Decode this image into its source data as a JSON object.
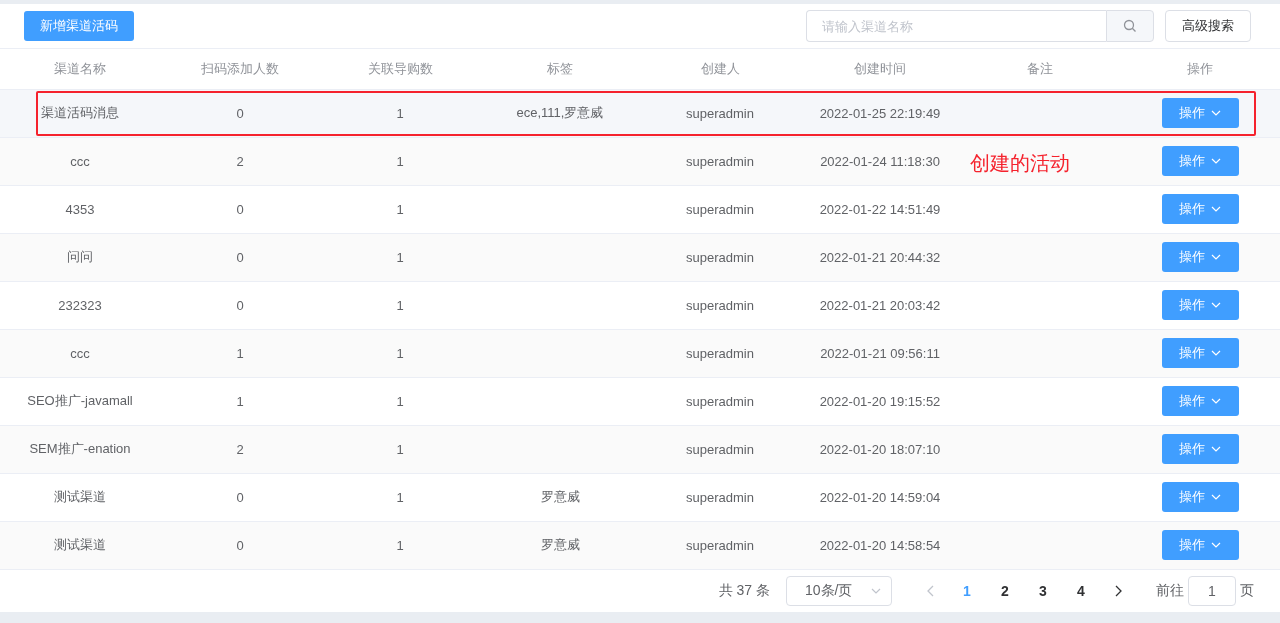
{
  "toolbar": {
    "add_button": "新增渠道活码",
    "search": {
      "placeholder": "请输入渠道名称"
    },
    "advanced_button": "高级搜索"
  },
  "table": {
    "columns": [
      "渠道名称",
      "扫码添加人数",
      "关联导购数",
      "标签",
      "创建人",
      "创建时间",
      "备注",
      "操作"
    ],
    "rows": [
      {
        "cells": [
          "渠道活码消息",
          "0",
          "1",
          "ece,111,罗意威",
          "superadmin",
          "2022-01-25 22:19:49",
          ""
        ],
        "action": "操作",
        "highlighted": true
      },
      {
        "cells": [
          "ccc",
          "2",
          "1",
          "",
          "superadmin",
          "2022-01-24 11:18:30",
          ""
        ],
        "action": "操作",
        "highlighted": false
      },
      {
        "cells": [
          "4353",
          "0",
          "1",
          "",
          "superadmin",
          "2022-01-22 14:51:49",
          ""
        ],
        "action": "操作",
        "highlighted": false
      },
      {
        "cells": [
          "问问",
          "0",
          "1",
          "",
          "superadmin",
          "2022-01-21 20:44:32",
          ""
        ],
        "action": "操作",
        "highlighted": false
      },
      {
        "cells": [
          "232323",
          "0",
          "1",
          "",
          "superadmin",
          "2022-01-21 20:03:42",
          ""
        ],
        "action": "操作",
        "highlighted": false
      },
      {
        "cells": [
          "ccc",
          "1",
          "1",
          "",
          "superadmin",
          "2022-01-21 09:56:11",
          ""
        ],
        "action": "操作",
        "highlighted": false
      },
      {
        "cells": [
          "SEO推广-javamall",
          "1",
          "1",
          "",
          "superadmin",
          "2022-01-20 19:15:52",
          ""
        ],
        "action": "操作",
        "highlighted": false
      },
      {
        "cells": [
          "SEM推广-enation",
          "2",
          "1",
          "",
          "superadmin",
          "2022-01-20 18:07:10",
          ""
        ],
        "action": "操作",
        "highlighted": false
      },
      {
        "cells": [
          "测试渠道",
          "0",
          "1",
          "罗意威",
          "superadmin",
          "2022-01-20 14:59:04",
          ""
        ],
        "action": "操作",
        "highlighted": false
      },
      {
        "cells": [
          "测试渠道",
          "0",
          "1",
          "罗意威",
          "superadmin",
          "2022-01-20 14:58:54",
          ""
        ],
        "action": "操作",
        "highlighted": false
      }
    ]
  },
  "annotation": {
    "text": "创建的活动"
  },
  "pagination": {
    "total": "共 37 条",
    "page_size": "10条/页",
    "pages": [
      {
        "label": "1",
        "selected": true
      },
      {
        "label": "2",
        "selected": false
      },
      {
        "label": "3",
        "selected": false
      },
      {
        "label": "4",
        "selected": false
      }
    ],
    "goto_label": "前往",
    "goto_value": "1",
    "goto_suffix": "页"
  }
}
